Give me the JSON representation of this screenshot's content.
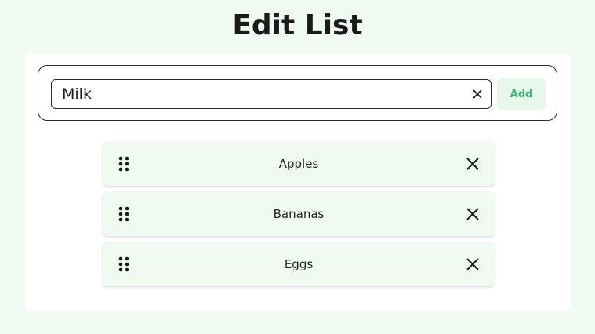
{
  "page": {
    "title": "Edit List"
  },
  "entry": {
    "value": "Milk",
    "add_label": "Add",
    "clear_icon": "close-icon"
  },
  "items": [
    {
      "label": "Apples",
      "handle_icon": "drag-handle-icon",
      "remove_icon": "close-icon"
    },
    {
      "label": "Bananas",
      "handle_icon": "drag-handle-icon",
      "remove_icon": "close-icon"
    },
    {
      "label": "Eggs",
      "handle_icon": "drag-handle-icon",
      "remove_icon": "close-icon"
    }
  ],
  "colors": {
    "background": "#effaf0",
    "card": "#ffffff",
    "item_background": "#effaf0",
    "add_button_bg": "#e5f8ea",
    "add_button_text": "#33bb77"
  }
}
